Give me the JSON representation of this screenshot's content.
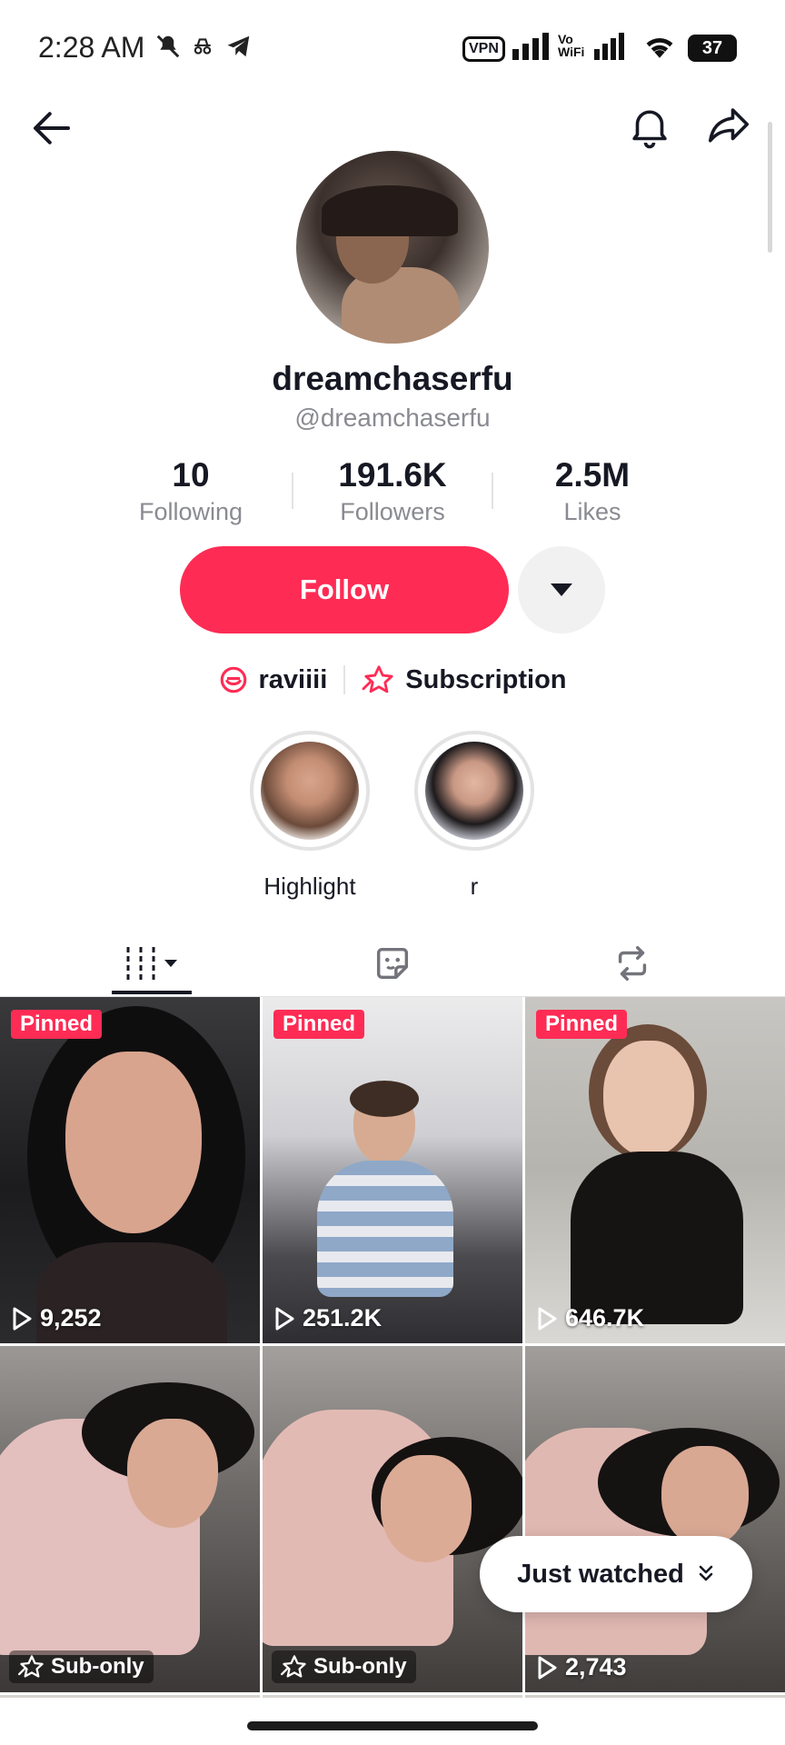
{
  "status_bar": {
    "time": "2:28 AM",
    "vpn": "VPN",
    "vowifi_top": "Vo",
    "vowifi_bottom": "WiFi",
    "battery": "37"
  },
  "profile": {
    "display_name": "dreamchaserfu",
    "username": "@dreamchaserfu",
    "stats": [
      {
        "value": "10",
        "label": "Following"
      },
      {
        "value": "191.6K",
        "label": "Followers"
      },
      {
        "value": "2.5M",
        "label": "Likes"
      }
    ],
    "follow_label": "Follow",
    "links": [
      {
        "label": "raviiii",
        "icon": "lemon8-icon"
      },
      {
        "label": "Subscription",
        "icon": "subscription-star-icon"
      }
    ]
  },
  "highlights": [
    {
      "label": "Highlight"
    },
    {
      "label": "r"
    }
  ],
  "tabs": [
    {
      "name": "videos",
      "icon": "grid-bars-icon",
      "active": true
    },
    {
      "name": "favorites",
      "icon": "sticker-icon",
      "active": false
    },
    {
      "name": "reposts",
      "icon": "repost-icon",
      "active": false
    }
  ],
  "videos": [
    {
      "badge": "Pinned",
      "views": "9,252"
    },
    {
      "badge": "Pinned",
      "views": "251.2K"
    },
    {
      "badge": "Pinned",
      "views": "646.7K"
    },
    {
      "badge": "Sub-only",
      "views": ""
    },
    {
      "badge": "Sub-only",
      "views": ""
    },
    {
      "badge": "",
      "views": "2,743"
    }
  ],
  "just_watched": {
    "label": "Just watched"
  },
  "colors": {
    "accent": "#fe2c55",
    "text_primary": "#161823",
    "text_secondary": "#8a8b91"
  }
}
